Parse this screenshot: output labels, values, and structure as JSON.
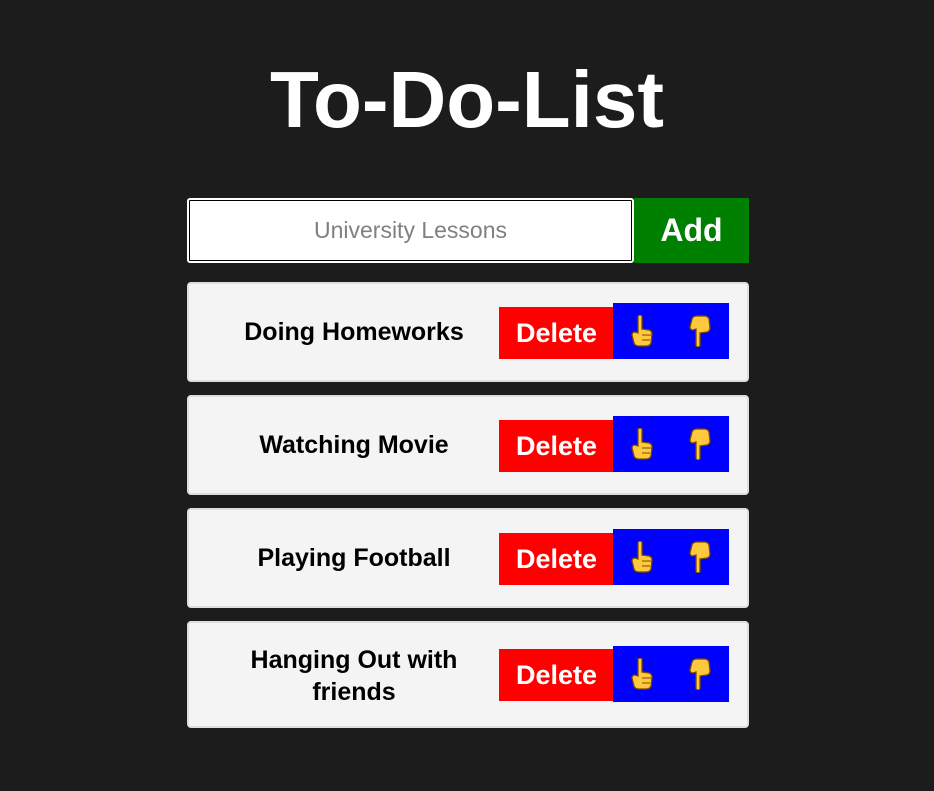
{
  "app": {
    "title": "To-Do-List"
  },
  "input": {
    "placeholder": "University Lessons",
    "value": ""
  },
  "add_button": {
    "label": "Add"
  },
  "colors": {
    "background": "#1c1c1c",
    "add_button": "#008000",
    "delete_button": "#ff0000",
    "vote_box": "#0000ff",
    "item_background": "#f4f4f4",
    "hand_icon": "#ffc83d"
  },
  "todos": [
    {
      "text": "Doing Homeworks",
      "delete_label": "Delete",
      "up_icon": "pointing-up-icon",
      "down_icon": "pointing-down-icon"
    },
    {
      "text": "Watching Movie",
      "delete_label": "Delete",
      "up_icon": "pointing-up-icon",
      "down_icon": "pointing-down-icon"
    },
    {
      "text": "Playing Football",
      "delete_label": "Delete",
      "up_icon": "pointing-up-icon",
      "down_icon": "pointing-down-icon"
    },
    {
      "text": "Hanging Out with friends",
      "delete_label": "Delete",
      "up_icon": "pointing-up-icon",
      "down_icon": "pointing-down-icon"
    }
  ]
}
